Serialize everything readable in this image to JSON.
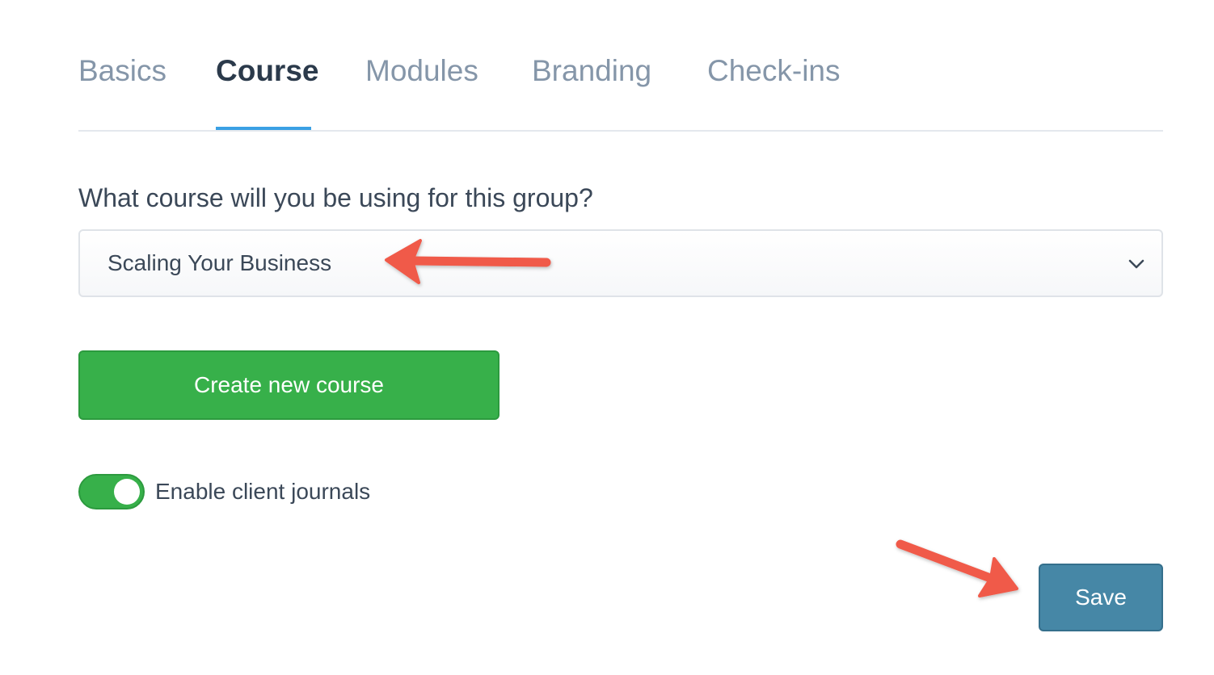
{
  "tabs": [
    {
      "label": "Basics",
      "active": false
    },
    {
      "label": "Course",
      "active": true
    },
    {
      "label": "Modules",
      "active": false
    },
    {
      "label": "Branding",
      "active": false
    },
    {
      "label": "Check-ins",
      "active": false
    }
  ],
  "course": {
    "question": "What course will you be using for this group?",
    "selected_course": "Scaling Your Business",
    "create_button_label": "Create new course"
  },
  "journals": {
    "label": "Enable client journals",
    "enabled": true
  },
  "actions": {
    "save_label": "Save"
  },
  "icons": {
    "select_chevron": "chevron-down-icon"
  },
  "colors": {
    "accent_green": "#37b04a",
    "save_blue": "#4687a6",
    "tab_underline": "#3aa0e4",
    "annotation_arrow": "#f05a4a"
  }
}
